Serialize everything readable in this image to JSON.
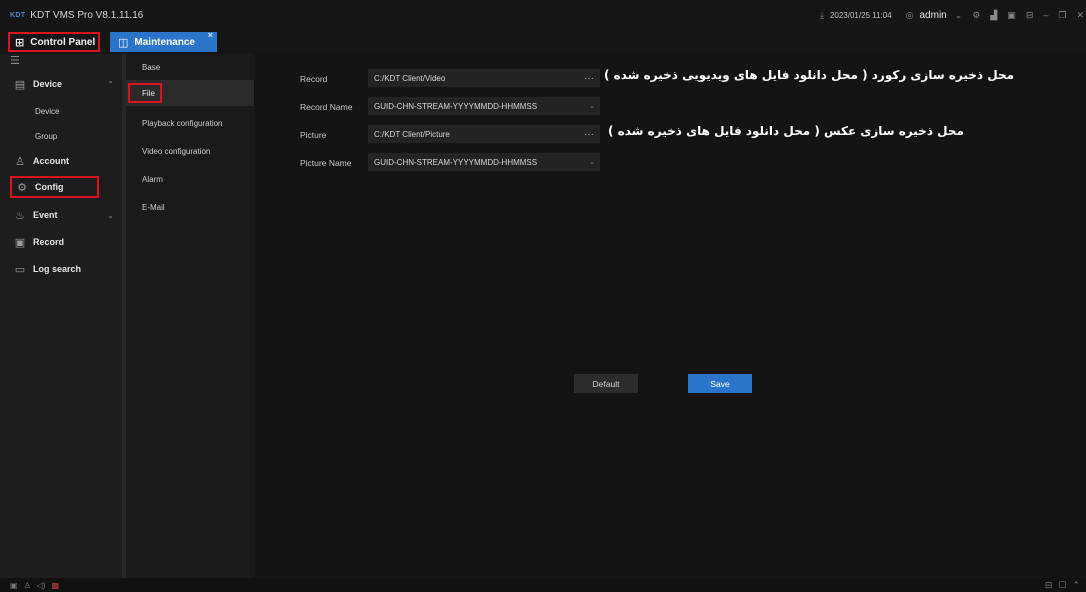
{
  "app": {
    "logo": "KDT",
    "title": "KDT VMS Pro V8.1.11.16"
  },
  "topbar": {
    "datetime": "2023/01/25 11:04",
    "user": "admin",
    "icons": [
      "download-icon",
      "user-icon",
      "chevron-down-icon",
      "settings-icon",
      "chart-icon",
      "layout-icon",
      "lock-icon",
      "minimize-icon",
      "restore-icon",
      "close-icon"
    ]
  },
  "tabs": {
    "control_panel": "Control Panel",
    "maintenance": "Maintenance",
    "close": "×"
  },
  "sidebar": {
    "items": [
      {
        "label": "Device",
        "icon": "device-icon",
        "expanded": true
      },
      {
        "label": "Device",
        "sub": true
      },
      {
        "label": "Group",
        "sub": true
      },
      {
        "label": "Account",
        "icon": "account-icon"
      },
      {
        "label": "Config",
        "icon": "config-icon",
        "selected": true
      },
      {
        "label": "Event",
        "icon": "event-icon",
        "expandable": true
      },
      {
        "label": "Record",
        "icon": "record-icon"
      },
      {
        "label": "Log search",
        "icon": "log-search-icon"
      }
    ]
  },
  "submenu": {
    "items": [
      "Base",
      "File",
      "Playback configuration",
      "Video configuration",
      "Alarm",
      "E-Mail"
    ],
    "active": "File"
  },
  "form": {
    "record_label": "Record",
    "record_value": "C:/KDT Client/Video",
    "record_name_label": "Record Name",
    "record_name_value": "GUID-CHN-STREAM-YYYYMMDD-HHMMSS",
    "picture_label": "Picture",
    "picture_value": "C:/KDT Client/Picture",
    "picture_name_label": "Picture Name",
    "picture_name_value": "GUID-CHN-STREAM-YYYYMMDD-HHMMSS",
    "browse": "···"
  },
  "annotations": {
    "record_note": "محل ذخیره سازی رکورد ( محل دانلود فایل های ویدیویی ذخیره شده )",
    "picture_note": "محل ذخیره سازی عکس ( محل دانلود فایل های ذخیره شده )"
  },
  "buttons": {
    "default": "Default",
    "save": "Save"
  },
  "colors": {
    "accent": "#2a74c9",
    "highlight_box": "#d9141e",
    "background": "#141414"
  }
}
